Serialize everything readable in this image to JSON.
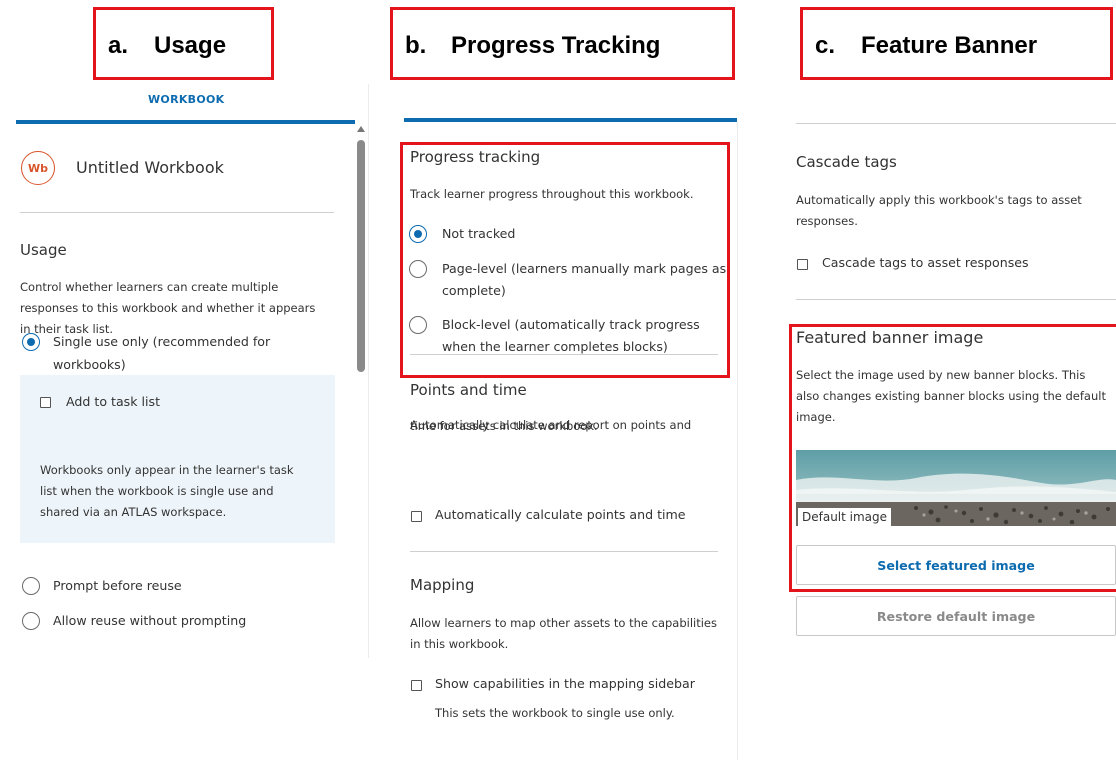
{
  "captions": {
    "a": {
      "letter": "a.",
      "title": "Usage"
    },
    "b": {
      "letter": "b.",
      "title": "Progress Tracking"
    },
    "c": {
      "letter": "c.",
      "title": "Feature Banner"
    }
  },
  "panel_a": {
    "tab_label": "WORKBOOK",
    "workbook_badge": "Wb",
    "workbook_title": "Untitled Workbook",
    "usage": {
      "heading": "Usage",
      "description_lines": [
        "Control whether learners can create multiple",
        "responses to this workbook and whether it appears",
        "in their task list."
      ],
      "options": [
        {
          "label_lines": [
            "Single use only (recommended for",
            "workbooks)"
          ],
          "selected": true
        },
        {
          "label_lines": [
            "Prompt before reuse"
          ],
          "selected": false
        },
        {
          "label_lines": [
            "Allow reuse without prompting"
          ],
          "selected": false
        }
      ],
      "task_list_checkbox": "Add to task list",
      "task_list_note_lines": [
        "Workbooks only appear in the learner's task",
        "list when the workbook is single use and",
        "shared via an ATLAS workspace."
      ]
    }
  },
  "panel_b": {
    "progress": {
      "heading": "Progress tracking",
      "description": "Track learner progress throughout this workbook.",
      "options": [
        {
          "label_lines": [
            "Not tracked"
          ],
          "selected": true
        },
        {
          "label_lines": [
            "Page-level (learners manually mark pages as",
            "complete)"
          ],
          "selected": false
        },
        {
          "label_lines": [
            "Block-level (automatically track progress",
            "when the learner completes blocks)"
          ],
          "selected": false
        }
      ]
    },
    "points": {
      "heading": "Points and time",
      "description_lines": [
        "Automatically calculate and report on points and",
        "time for assets in this workbook."
      ],
      "checkbox": "Automatically calculate points and time"
    },
    "mapping": {
      "heading": "Mapping",
      "description_lines": [
        "Allow learners to map other assets to the capabilities",
        "in this workbook."
      ],
      "checkbox": "Show capabilities in the mapping sidebar",
      "note": "This sets the workbook to single use only."
    }
  },
  "panel_c": {
    "cascade": {
      "heading": "Cascade tags",
      "description_lines": [
        "Automatically apply this workbook's tags to asset",
        "responses."
      ],
      "checkbox": "Cascade tags to asset responses"
    },
    "banner": {
      "heading": "Featured banner image",
      "description_lines": [
        "Select the image used by new banner blocks. This",
        "also changes existing banner blocks using the default",
        "image."
      ],
      "image_caption": "Default image",
      "select_button": "Select featured image",
      "restore_button": "Restore default image"
    }
  },
  "colors": {
    "accent": "#0d6bb0",
    "highlight_box": "#e3141b",
    "badge": "#d9542b",
    "note_bg": "#eef5fa"
  }
}
